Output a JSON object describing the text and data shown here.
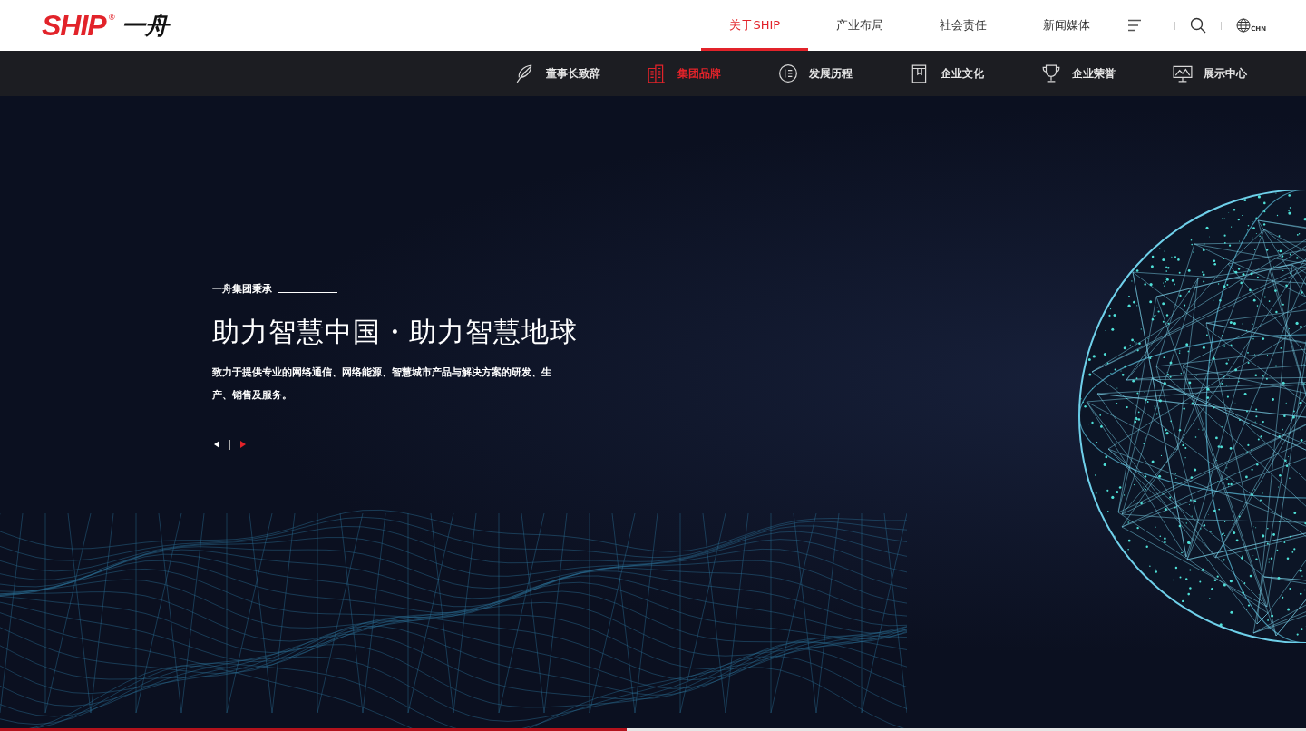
{
  "header": {
    "logo": {
      "brand": "SHIP",
      "mark": "®",
      "cn": "一舟"
    },
    "nav": [
      {
        "label": "关于SHIP",
        "selected": true
      },
      {
        "label": "产业布局",
        "selected": false
      },
      {
        "label": "社会责任",
        "selected": false
      },
      {
        "label": "新闻媒体",
        "selected": false
      }
    ],
    "language": "CHN"
  },
  "subnav": [
    {
      "label": "董事长致辞",
      "selected": false
    },
    {
      "label": "集团品牌",
      "selected": true
    },
    {
      "label": "发展历程",
      "selected": false
    },
    {
      "label": "企业文化",
      "selected": false
    },
    {
      "label": "企业荣誉",
      "selected": false
    },
    {
      "label": "展示中心",
      "selected": false
    }
  ],
  "hero": {
    "eyebrow": "一舟集团秉承",
    "title": "助力智慧中国・助力智慧地球",
    "description": "致力于提供专业的网络通信、网络能源、智慧城市产品与解决方案的研发、生产、销售及服务。",
    "slide_progress": {
      "level": 0.48
    }
  }
}
